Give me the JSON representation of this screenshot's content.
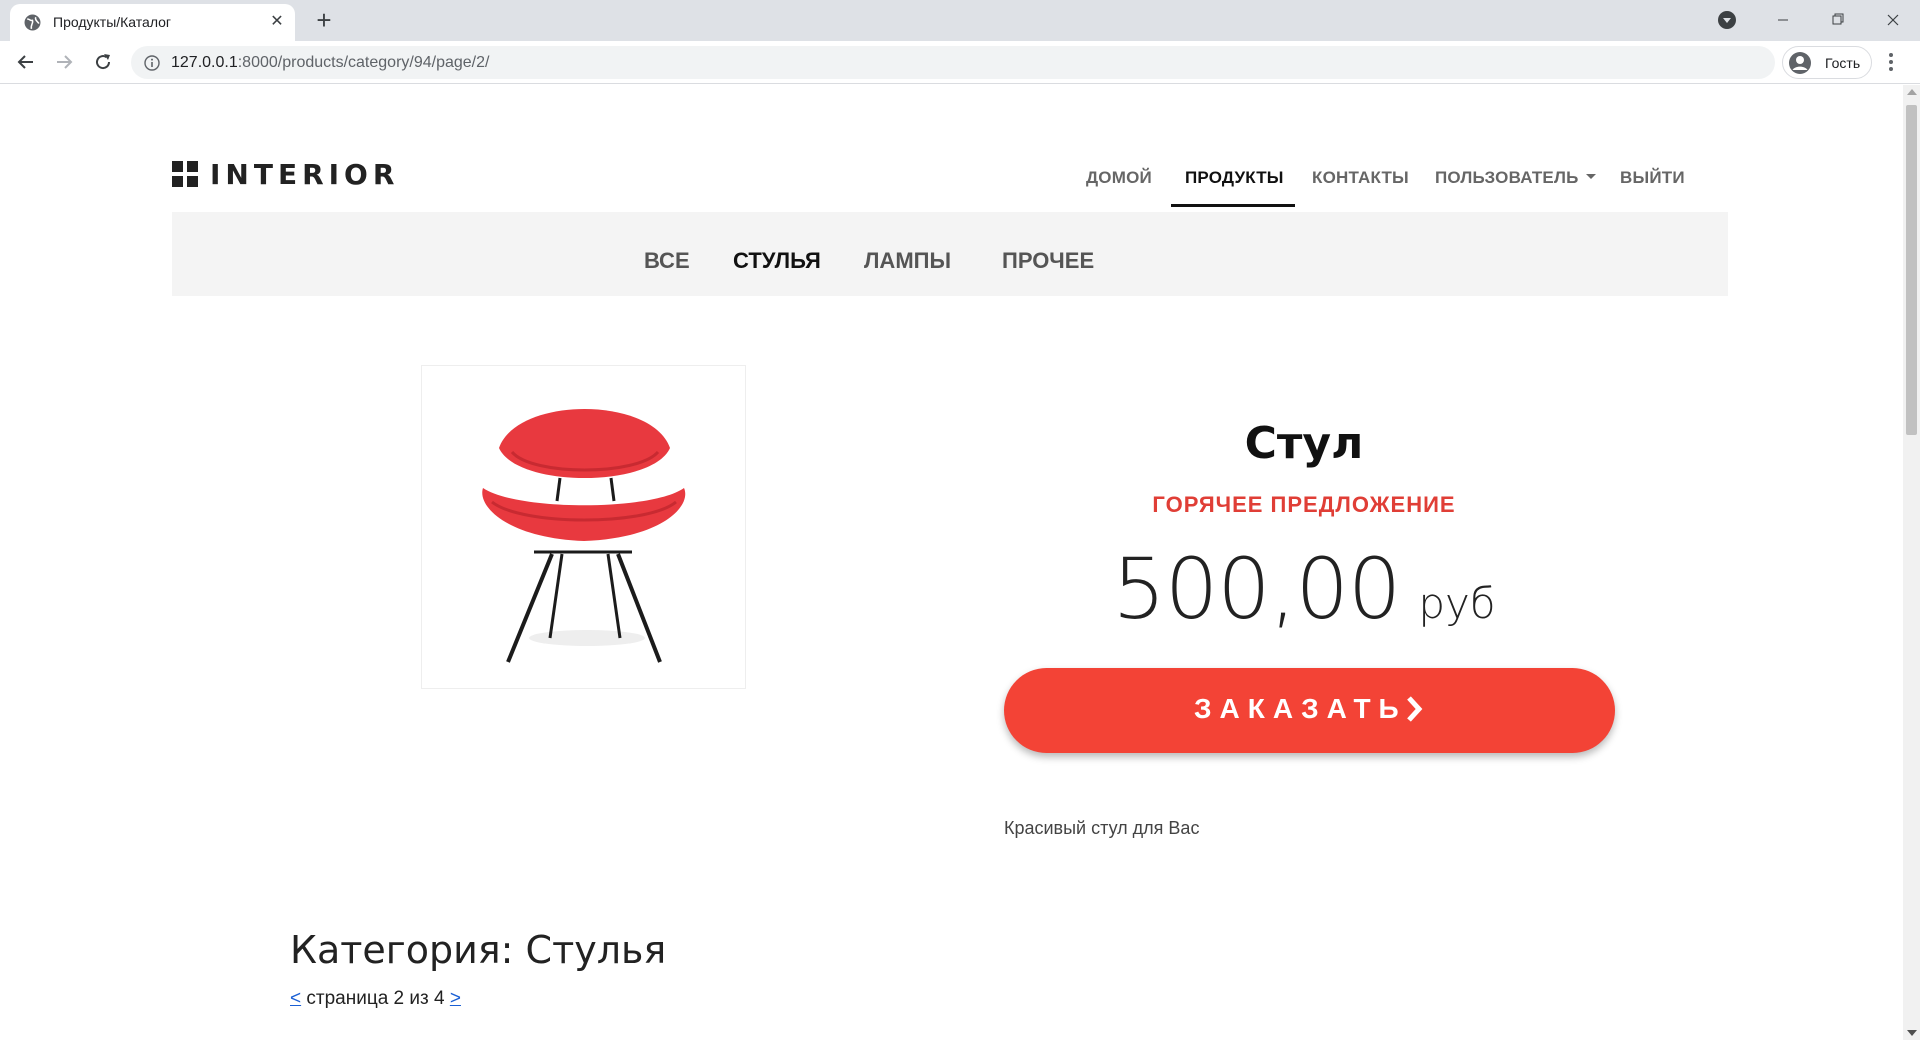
{
  "browser": {
    "tab_title": "Продукты/Каталог",
    "tab_close": "✕",
    "new_tab": "+",
    "url_host": "127.0.0.1",
    "url_path": ":8000/products/category/94/page/2/",
    "profile_label": "Гость"
  },
  "site": {
    "logo_text": "INTERIOR",
    "nav": {
      "home": "ДОМОЙ",
      "products": "ПРОДУКТЫ",
      "contacts": "КОНТАКТЫ",
      "user": "ПОЛЬЗОВАТЕЛЬ",
      "logout": "ВЫЙТИ",
      "active": "products"
    },
    "subnav": {
      "all": "ВСЕ",
      "chairs": "СТУЛЬЯ",
      "lamps": "ЛАМПЫ",
      "other": "ПРОЧЕЕ",
      "active": "chairs"
    }
  },
  "product": {
    "title": "Стул",
    "hot_label": "ГОРЯЧЕЕ ПРЕДЛОЖЕНИЕ",
    "price": "500,00",
    "currency": "руб",
    "order_label": "ЗАКАЗАТЬ",
    "description": "Красивый стул для Вас",
    "image_icon": "red-chair-image"
  },
  "category": {
    "heading": "Категория: Стулья",
    "prev": "<",
    "pager_text": "страница 2 из 4",
    "next": ">"
  },
  "colors": {
    "accent_red": "#f34336",
    "hot_red": "#e03e36",
    "link_blue": "#1a5fd4",
    "subnav_bg": "#f4f4f4"
  }
}
